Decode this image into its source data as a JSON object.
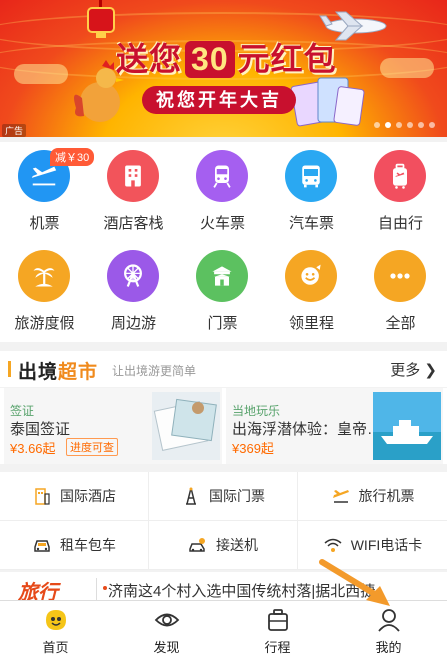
{
  "banner": {
    "title_pre": "送您",
    "title_num": "30",
    "title_post": "元红包",
    "subtitle": "祝您开年大吉",
    "ad_label": "广告",
    "accent": "#c8102e"
  },
  "services": [
    {
      "label": "机票",
      "icon": "airplane-icon",
      "color": "#2196f3",
      "badge": "减￥30"
    },
    {
      "label": "酒店客栈",
      "icon": "hotel-icon",
      "color": "#f2545b"
    },
    {
      "label": "火车票",
      "icon": "train-icon",
      "color": "#a55ff0"
    },
    {
      "label": "汽车票",
      "icon": "bus-icon",
      "color": "#2aa8f2"
    },
    {
      "label": "自由行",
      "icon": "luggage-icon",
      "color": "#f24f5f"
    },
    {
      "label": "旅游度假",
      "icon": "palm-icon",
      "color": "#f5a623"
    },
    {
      "label": "周边游",
      "icon": "ferris-wheel-icon",
      "color": "#9b59e8"
    },
    {
      "label": "门票",
      "icon": "gate-icon",
      "color": "#5cc160"
    },
    {
      "label": "领里程",
      "icon": "smile-icon",
      "color": "#f5a623"
    },
    {
      "label": "全部",
      "icon": "more-icon",
      "color": "#f5a623"
    }
  ],
  "section": {
    "brand_a": "出境",
    "brand_b": "超市",
    "slogan": "让出境游更简单",
    "more": "更多 ❯"
  },
  "cards": [
    {
      "tag": "签证",
      "title": "泰国签证",
      "price": "¥3.66起",
      "tip": "进度可查"
    },
    {
      "tag": "当地玩乐",
      "title": "出海浮潜体验：皇帝…",
      "price": "¥369起"
    }
  ],
  "links": [
    {
      "label": "国际酒店",
      "icon": "building-icon"
    },
    {
      "label": "国际门票",
      "icon": "tower-icon"
    },
    {
      "label": "旅行机票",
      "icon": "plane-small-icon"
    },
    {
      "label": "租车包车",
      "icon": "car-icon"
    },
    {
      "label": "接送机",
      "icon": "pickup-icon"
    },
    {
      "label": "WIFI电话卡",
      "icon": "wifi-icon"
    }
  ],
  "news": {
    "logo": "旅行",
    "text": "济南这4个村入选中国传统村落|据北西捷，"
  },
  "tabs": [
    {
      "label": "首页",
      "icon": "home-icon"
    },
    {
      "label": "发现",
      "icon": "eye-icon"
    },
    {
      "label": "行程",
      "icon": "suitcase-icon"
    },
    {
      "label": "我的",
      "icon": "user-icon"
    }
  ]
}
